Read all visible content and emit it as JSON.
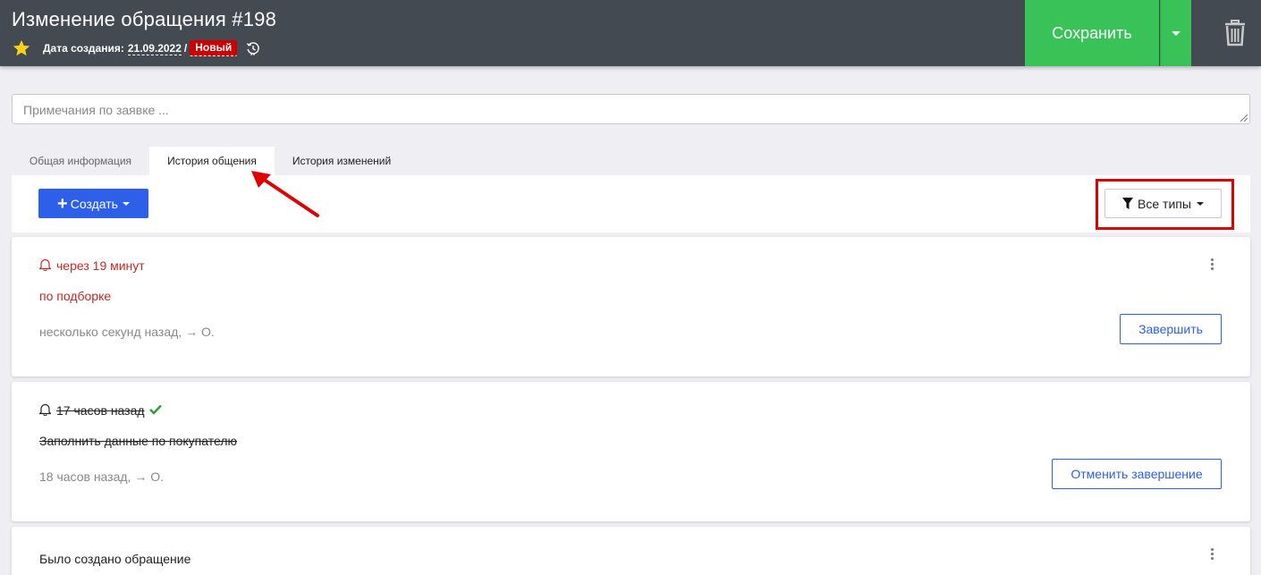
{
  "header": {
    "title": "Изменение обращения #198",
    "created_label": "Дата создания:",
    "created_date": "21.09.2022",
    "separator": "/",
    "status_badge": "Новый",
    "save_label": "Сохранить"
  },
  "notes": {
    "placeholder": "Примечания по заявке ..."
  },
  "tabs": [
    {
      "label": "Общая информация",
      "active": false
    },
    {
      "label": "История общения",
      "active": true
    },
    {
      "label": "История изменений",
      "active": false
    }
  ],
  "toolbar": {
    "create_label": "Создать",
    "filter_label": "Все типы"
  },
  "cards": [
    {
      "reminder": "через 19 минут",
      "text": "по подборке",
      "meta": "несколько секунд назад, → О.",
      "action": "Завершить"
    },
    {
      "reminder": "17 часов назад",
      "text": "Заполнить данные по покупателю",
      "meta": "18 часов назад, → О.",
      "action": "Отменить завершение"
    },
    {
      "text": "Было создано обращение"
    }
  ],
  "colors": {
    "header_bg": "#444a52",
    "save_green": "#38c257",
    "primary_blue": "#2d5fe8",
    "badge_red": "#cc0000",
    "reminder_red": "#c62828",
    "check_green": "#2e9e3e",
    "annotation_red": "#e00000"
  },
  "icons": [
    "star-icon",
    "history-icon",
    "caret-down-icon",
    "trash-icon",
    "plus-icon",
    "filter-icon",
    "bell-icon",
    "check-icon",
    "kebab-menu-icon"
  ]
}
